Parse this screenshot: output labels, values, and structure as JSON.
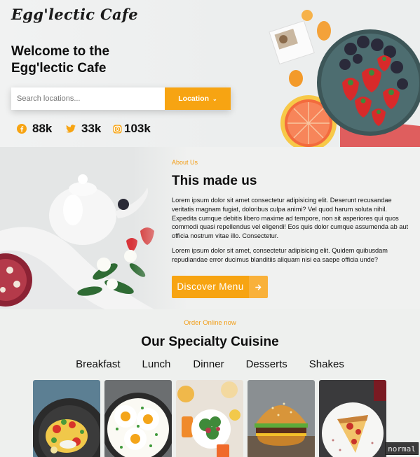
{
  "brand": {
    "logo": "Egg'lectic Cafe"
  },
  "hero": {
    "welcome": "Welcome to the Egg'lectic Cafe",
    "search_placeholder": "Search locations...",
    "location_button": "Location",
    "socials": [
      {
        "icon": "facebook-icon",
        "count": "88k"
      },
      {
        "icon": "twitter-icon",
        "count": "33k"
      },
      {
        "icon": "instagram-icon",
        "count": "103k"
      }
    ]
  },
  "about": {
    "kicker": "About Us",
    "title": "This made us",
    "paragraph1": "Lorem ipsum dolor sit amet consectetur adipisicing elit. Deserunt recusandae veritatis magnam fugiat, doloribus culpa animi? Vel quod harum soluta nihil. Expedita cumque debitis libero maxime ad tempore, non sit asperiores qui quos commodi quasi repellendus vel eligendi! Eos quis dolor cumque assumenda ab aut officia nostrum vitae illo. Consectetur.",
    "paragraph2": "Lorem ipsum dolor sit amet, consectetur adipisicing elit. Quidem quibusdam repudiandae error ducimus blanditiis aliquam nisi ea saepe officia unde?",
    "button": "Discover Menu"
  },
  "cuisine": {
    "kicker": "Order Online now",
    "title": "Our Specialty Cuisine",
    "tabs": [
      "Breakfast",
      "Lunch",
      "Dinner",
      "Desserts",
      "Shakes"
    ]
  },
  "status_badge": "normal",
  "colors": {
    "accent": "#f7a412",
    "accent_light": "#f9b13a",
    "background": "#eef0ee"
  }
}
